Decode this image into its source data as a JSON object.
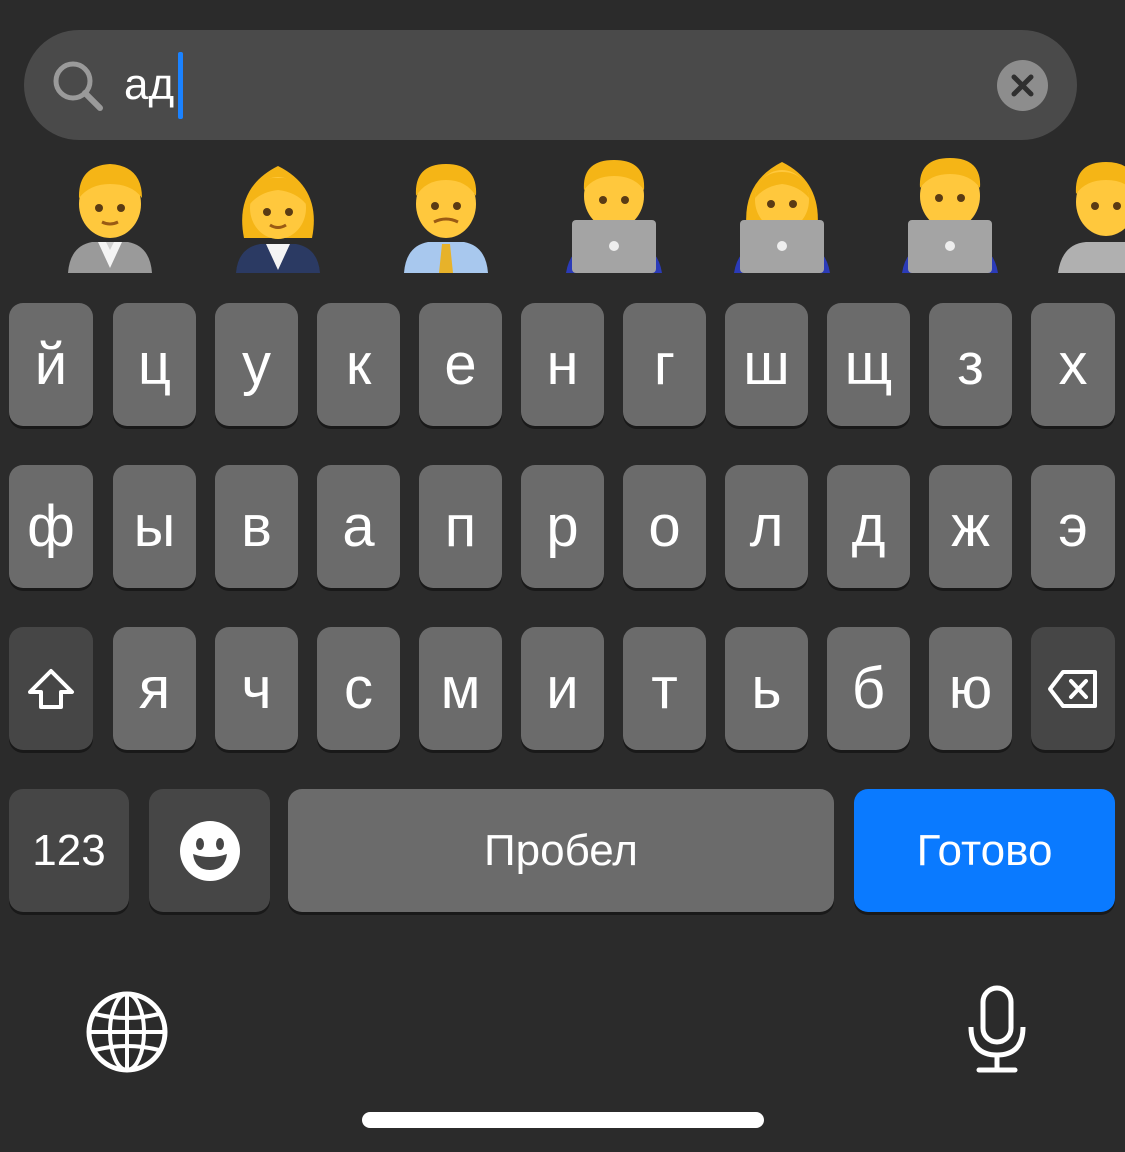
{
  "search": {
    "value": "ад",
    "icon": "search-icon",
    "clear_icon": "clear-icon"
  },
  "emoji_results": [
    {
      "name": "person-office-worker-emoji",
      "tone": "gray-suit"
    },
    {
      "name": "woman-office-worker-emoji",
      "tone": "navy-suit"
    },
    {
      "name": "man-office-worker-emoji",
      "tone": "blue-shirt"
    },
    {
      "name": "technologist-emoji",
      "tone": "laptop"
    },
    {
      "name": "woman-technologist-emoji",
      "tone": "laptop"
    },
    {
      "name": "man-technologist-emoji",
      "tone": "laptop"
    },
    {
      "name": "person-emoji",
      "tone": "gray"
    }
  ],
  "keyboard": {
    "row1": [
      "й",
      "ц",
      "у",
      "к",
      "е",
      "н",
      "г",
      "ш",
      "щ",
      "з",
      "х"
    ],
    "row2": [
      "ф",
      "ы",
      "в",
      "а",
      "п",
      "р",
      "о",
      "л",
      "д",
      "ж",
      "э"
    ],
    "row3": [
      "я",
      "ч",
      "с",
      "м",
      "и",
      "т",
      "ь",
      "б",
      "ю"
    ],
    "numbers_label": "123",
    "space_label": "Пробел",
    "done_label": "Готово",
    "accent_color": "#0a7aff",
    "icons": [
      "shift-icon",
      "backspace-icon",
      "emoji-icon",
      "globe-icon",
      "microphone-icon"
    ]
  }
}
